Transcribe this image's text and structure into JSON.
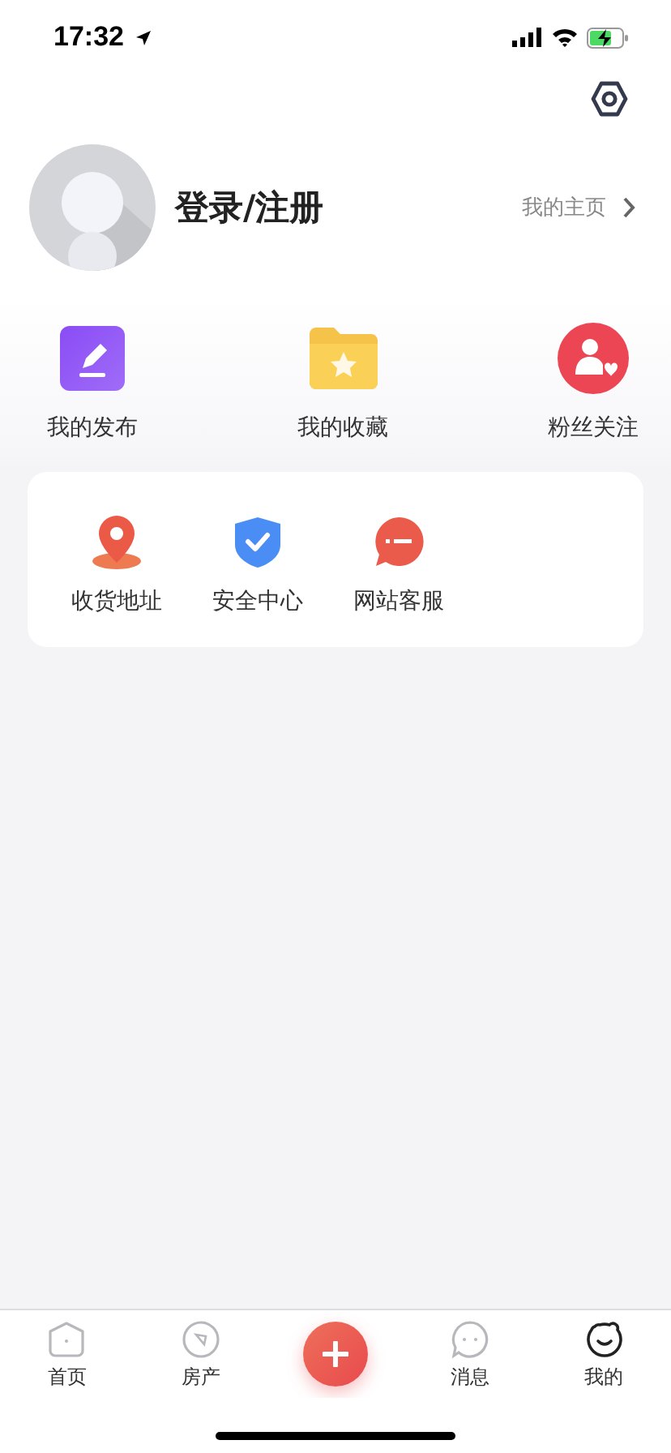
{
  "status_bar": {
    "time": "17:32"
  },
  "profile": {
    "login": "登录/注册",
    "homepage_link": "我的主页"
  },
  "quick_actions": [
    {
      "kind": "post",
      "label": "我的发布"
    },
    {
      "kind": "favorite",
      "label": "我的收藏"
    },
    {
      "kind": "fans",
      "label": "粉丝关注"
    }
  ],
  "services": [
    {
      "kind": "address",
      "label": "收货地址"
    },
    {
      "kind": "security",
      "label": "安全中心"
    },
    {
      "kind": "support",
      "label": "网站客服"
    }
  ],
  "tab_bar": [
    {
      "kind": "home",
      "label": "首页",
      "selected": false
    },
    {
      "kind": "property",
      "label": "房产",
      "selected": false
    },
    {
      "kind": "add"
    },
    {
      "kind": "message",
      "label": "消息",
      "selected": false
    },
    {
      "kind": "me",
      "label": "我的",
      "selected": true
    }
  ]
}
